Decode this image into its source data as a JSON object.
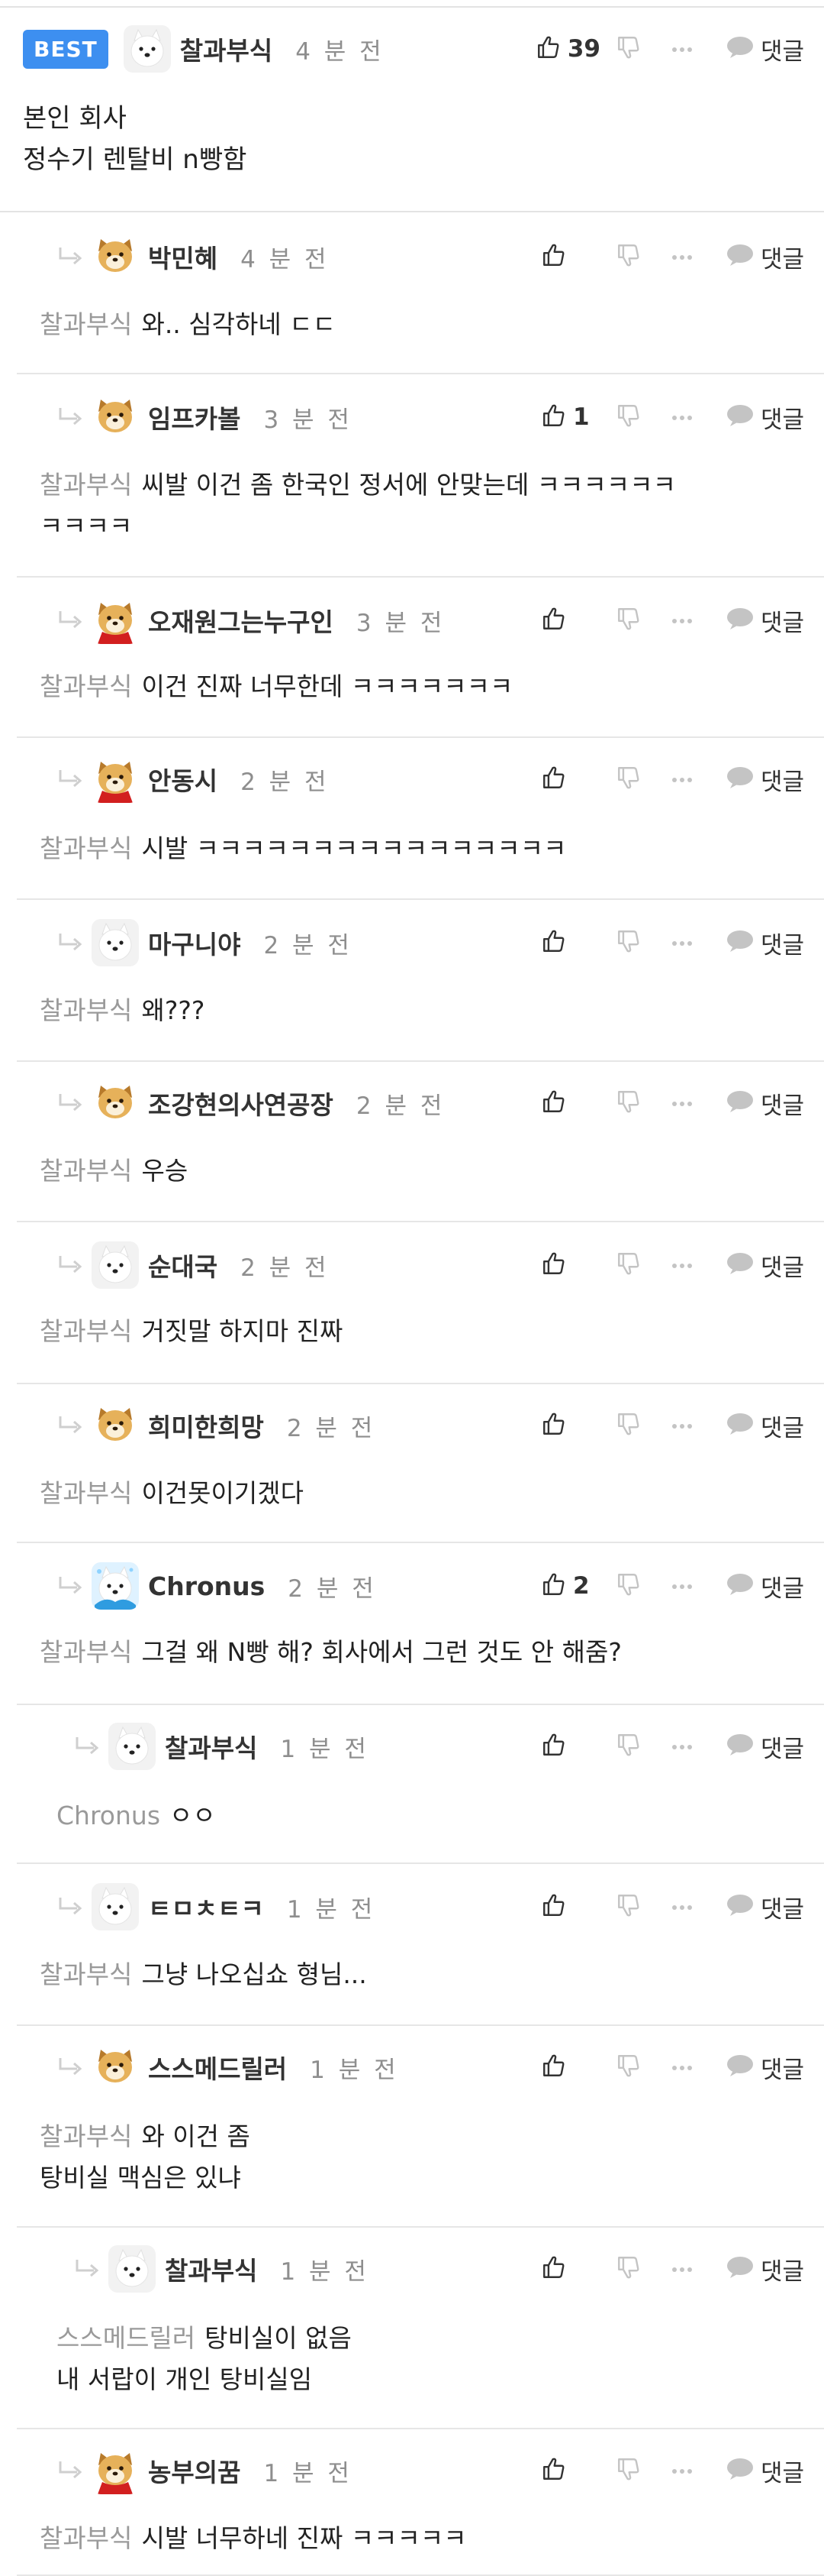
{
  "labels": {
    "best": "BEST",
    "reply": "댓글",
    "more": "···"
  },
  "colors": {
    "badge": "#3d8ff0",
    "mention": "#9a9a9a",
    "divider": "#e6e6e6"
  },
  "comments": [
    {
      "id": "c0",
      "best": true,
      "reply": false,
      "user": "찰과부식",
      "avatar": "white-dog",
      "time": "4 분 전",
      "likes": "39",
      "mention": "",
      "text": "본인 회사\n정수기 렌탈비 n빵함"
    },
    {
      "id": "c1",
      "reply": true,
      "user": "박민혜",
      "avatar": "shiba",
      "time": "4 분 전",
      "likes": "",
      "mention": "찰과부식",
      "text": "와.. 심각하네 ㄷㄷ"
    },
    {
      "id": "c2",
      "reply": true,
      "user": "임프카볼",
      "avatar": "shiba",
      "time": "3 분 전",
      "likes": "1",
      "mention": "찰과부식",
      "text": "씨발 이건 좀 한국인 정서에 안맞는데 ㅋㅋㅋㅋㅋㅋ\nㅋㅋㅋㅋ"
    },
    {
      "id": "c3",
      "reply": true,
      "user": "오재원그는누구인",
      "avatar": "shiba-red",
      "time": "3 분 전",
      "likes": "",
      "mention": "찰과부식",
      "text": "이건 진짜 너무한데 ㅋㅋㅋㅋㅋㅋㅋ"
    },
    {
      "id": "c4",
      "reply": true,
      "user": "안동시",
      "avatar": "shiba-red",
      "time": "2 분 전",
      "likes": "",
      "mention": "찰과부식",
      "text": "시발 ㅋㅋㅋㅋㅋㅋㅋㅋㅋㅋㅋㅋㅋㅋㅋㅋ"
    },
    {
      "id": "c5",
      "reply": true,
      "user": "마구니야",
      "avatar": "white-dog",
      "time": "2 분 전",
      "likes": "",
      "mention": "찰과부식",
      "text": "왜???"
    },
    {
      "id": "c6",
      "reply": true,
      "user": "조강현의사연공장",
      "avatar": "shiba",
      "time": "2 분 전",
      "likes": "",
      "mention": "찰과부식",
      "text": "우승"
    },
    {
      "id": "c7",
      "reply": true,
      "user": "순대국",
      "avatar": "white-dog",
      "time": "2 분 전",
      "likes": "",
      "mention": "찰과부식",
      "text": "거짓말 하지마 진짜"
    },
    {
      "id": "c8",
      "reply": true,
      "user": "희미한희망",
      "avatar": "shiba",
      "time": "2 분 전",
      "likes": "",
      "mention": "찰과부식",
      "text": "이건못이기겠다"
    },
    {
      "id": "c9",
      "reply": true,
      "user": "Chronus",
      "avatar": "white-dog-blue",
      "time": "2 분 전",
      "likes": "2",
      "mention": "찰과부식",
      "text": "그걸 왜 N빵 해? 회사에서 그런 것도 안 해줌?"
    },
    {
      "id": "c10",
      "reply": true,
      "nested": true,
      "user": "찰과부식",
      "avatar": "white-dog",
      "time": "1 분 전",
      "likes": "",
      "mention": "Chronus",
      "text": "ㅇㅇ"
    },
    {
      "id": "c11",
      "reply": true,
      "user": "ㅌㅁㅊㅌㅋ",
      "avatar": "white-dog",
      "time": "1 분 전",
      "likes": "",
      "mention": "찰과부식",
      "text": "그냥 나오십쇼 형님..."
    },
    {
      "id": "c12",
      "reply": true,
      "user": "스스메드릴러",
      "avatar": "shiba",
      "time": "1 분 전",
      "likes": "",
      "mention": "찰과부식",
      "text": "와 이건 좀\n탕비실 맥심은 있냐"
    },
    {
      "id": "c13",
      "reply": true,
      "nested": true,
      "user": "찰과부식",
      "avatar": "white-dog",
      "time": "1 분 전",
      "likes": "",
      "mention": "스스메드릴러",
      "text": "탕비실이 없음\n내 서랍이 개인 탕비실임"
    },
    {
      "id": "c14",
      "reply": true,
      "user": "농부의꿈",
      "avatar": "shiba-red",
      "time": "1 분 전",
      "likes": "",
      "mention": "찰과부식",
      "text": "시발 너무하네 진짜 ㅋㅋㅋㅋㅋ"
    }
  ]
}
